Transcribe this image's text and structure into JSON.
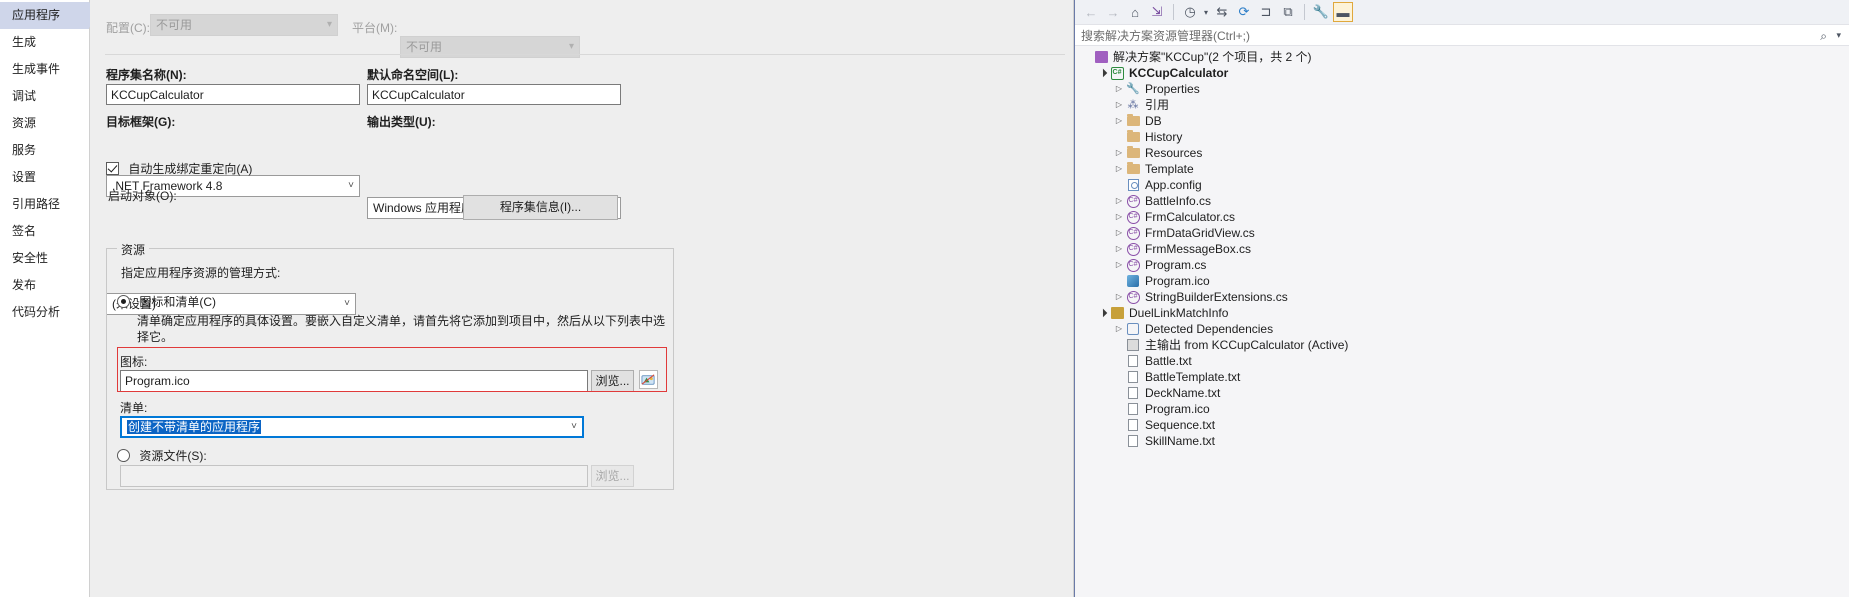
{
  "sidebar": {
    "items": [
      {
        "label": "应用程序",
        "selected": true
      },
      {
        "label": "生成",
        "selected": false
      },
      {
        "label": "生成事件",
        "selected": false
      },
      {
        "label": "调试",
        "selected": false
      },
      {
        "label": "资源",
        "selected": false
      },
      {
        "label": "服务",
        "selected": false
      },
      {
        "label": "设置",
        "selected": false
      },
      {
        "label": "引用路径",
        "selected": false
      },
      {
        "label": "签名",
        "selected": false
      },
      {
        "label": "安全性",
        "selected": false
      },
      {
        "label": "发布",
        "selected": false
      },
      {
        "label": "代码分析",
        "selected": false
      }
    ]
  },
  "main": {
    "configuration_label": "配置(C):",
    "configuration_value": "不可用",
    "platform_label": "平台(M):",
    "platform_value": "不可用",
    "assembly_name_label": "程序集名称(N):",
    "assembly_name_value": "KCCupCalculator",
    "default_namespace_label": "默认命名空间(L):",
    "default_namespace_value": "KCCupCalculator",
    "target_framework_label": "目标框架(G):",
    "target_framework_value": ".NET Framework 4.8",
    "output_type_label": "输出类型(U):",
    "output_type_value": "Windows 应用程序",
    "auto_binding_label": "自动生成绑定重定向(A)",
    "auto_binding_checked": true,
    "startup_object_label": "启动对象(O):",
    "startup_object_value": "(未设置)",
    "assembly_info_button": "程序集信息(I)...",
    "resources_group_title": "资源",
    "resources_desc": "指定应用程序资源的管理方式:",
    "icon_manifest_radio_label": "图标和清单(C)",
    "icon_manifest_radio_selected": true,
    "manifest_desc_line1": "清单确定应用程序的具体设置。要嵌入自定义清单，请首先将它添加到项目中，然后从以下列表中选",
    "manifest_desc_line2": "择它。",
    "icon_label": "图标:",
    "icon_value": "Program.ico",
    "icon_browse_button": "浏览...",
    "manifest_label": "清单:",
    "manifest_value": "创建不带清单的应用程序",
    "resource_file_radio_label": "资源文件(S):",
    "resource_file_radio_selected": false,
    "resource_file_value": "",
    "resource_file_browse_button": "浏览...",
    "highlight_color": "#e03a3a",
    "selection_color": "#0b64c4"
  },
  "solution_explorer": {
    "toolbar_icons": [
      {
        "name": "back-arrow-icon",
        "glyph": "←",
        "disabled": true
      },
      {
        "name": "forward-arrow-icon",
        "glyph": "→",
        "disabled": true
      },
      {
        "name": "home-icon",
        "glyph": "⌂",
        "disabled": false
      },
      {
        "name": "sync-with-active-document-icon",
        "glyph": "⇲",
        "disabled": false
      },
      {
        "name": "pending-changes-filter-icon",
        "glyph": "◷",
        "disabled": false
      },
      {
        "name": "show-all-files-icon",
        "glyph": "⇆",
        "disabled": false
      },
      {
        "name": "refresh-icon",
        "glyph": "⟳",
        "disabled": false
      },
      {
        "name": "collapse-all-icon",
        "glyph": "⊐",
        "disabled": false
      },
      {
        "name": "view-code-icon",
        "glyph": "⧉",
        "disabled": false
      },
      {
        "name": "properties-icon",
        "glyph": "🔧",
        "disabled": false
      },
      {
        "name": "preview-selected-items-icon",
        "glyph": "▬",
        "disabled": false
      }
    ],
    "search_placeholder": "搜索解决方案资源管理器(Ctrl+;)",
    "tree": [
      {
        "label": "解决方案\"KCCup\"(2 个项目，共 2 个)",
        "indent": 0,
        "twist": "",
        "icon": "solution-icon",
        "bold": false
      },
      {
        "label": "KCCupCalculator",
        "indent": 1,
        "twist": "expanded",
        "icon": "csharp-project-icon",
        "bold": true
      },
      {
        "label": "Properties",
        "indent": 2,
        "twist": "collapsed",
        "icon": "wrench-icon",
        "bold": false
      },
      {
        "label": "引用",
        "indent": 2,
        "twist": "collapsed",
        "icon": "references-icon",
        "bold": false
      },
      {
        "label": "DB",
        "indent": 2,
        "twist": "collapsed",
        "icon": "folder-icon",
        "bold": false
      },
      {
        "label": "History",
        "indent": 2,
        "twist": "",
        "icon": "folder-icon",
        "bold": false
      },
      {
        "label": "Resources",
        "indent": 2,
        "twist": "collapsed",
        "icon": "folder-icon",
        "bold": false
      },
      {
        "label": "Template",
        "indent": 2,
        "twist": "collapsed",
        "icon": "folder-icon",
        "bold": false
      },
      {
        "label": "App.config",
        "indent": 2,
        "twist": "",
        "icon": "config-file-icon",
        "bold": false
      },
      {
        "label": "BattleInfo.cs",
        "indent": 2,
        "twist": "collapsed",
        "icon": "csharp-file-icon",
        "bold": false
      },
      {
        "label": "FrmCalculator.cs",
        "indent": 2,
        "twist": "collapsed",
        "icon": "csharp-file-icon",
        "bold": false
      },
      {
        "label": "FrmDataGridView.cs",
        "indent": 2,
        "twist": "collapsed",
        "icon": "csharp-file-icon",
        "bold": false
      },
      {
        "label": "FrmMessageBox.cs",
        "indent": 2,
        "twist": "collapsed",
        "icon": "csharp-file-icon",
        "bold": false
      },
      {
        "label": "Program.cs",
        "indent": 2,
        "twist": "collapsed",
        "icon": "csharp-file-icon",
        "bold": false
      },
      {
        "label": "Program.ico",
        "indent": 2,
        "twist": "",
        "icon": "icon-file-icon",
        "bold": false
      },
      {
        "label": "StringBuilderExtensions.cs",
        "indent": 2,
        "twist": "collapsed",
        "icon": "csharp-file-icon",
        "bold": false
      },
      {
        "label": "DuelLinkMatchInfo",
        "indent": 1,
        "twist": "expanded",
        "icon": "setup-project-icon",
        "bold": false
      },
      {
        "label": "Detected Dependencies",
        "indent": 2,
        "twist": "collapsed",
        "icon": "dependencies-icon",
        "bold": false
      },
      {
        "label": "主输出 from KCCupCalculator (Active)",
        "indent": 2,
        "twist": "",
        "icon": "primary-output-icon",
        "bold": false
      },
      {
        "label": "Battle.txt",
        "indent": 2,
        "twist": "",
        "icon": "text-file-icon",
        "bold": false
      },
      {
        "label": "BattleTemplate.txt",
        "indent": 2,
        "twist": "",
        "icon": "text-file-icon",
        "bold": false
      },
      {
        "label": "DeckName.txt",
        "indent": 2,
        "twist": "",
        "icon": "text-file-icon",
        "bold": false
      },
      {
        "label": "Program.ico",
        "indent": 2,
        "twist": "",
        "icon": "text-file-icon",
        "bold": false
      },
      {
        "label": "Sequence.txt",
        "indent": 2,
        "twist": "",
        "icon": "text-file-icon",
        "bold": false
      },
      {
        "label": "SkillName.txt",
        "indent": 2,
        "twist": "",
        "icon": "text-file-icon",
        "bold": false
      }
    ]
  }
}
